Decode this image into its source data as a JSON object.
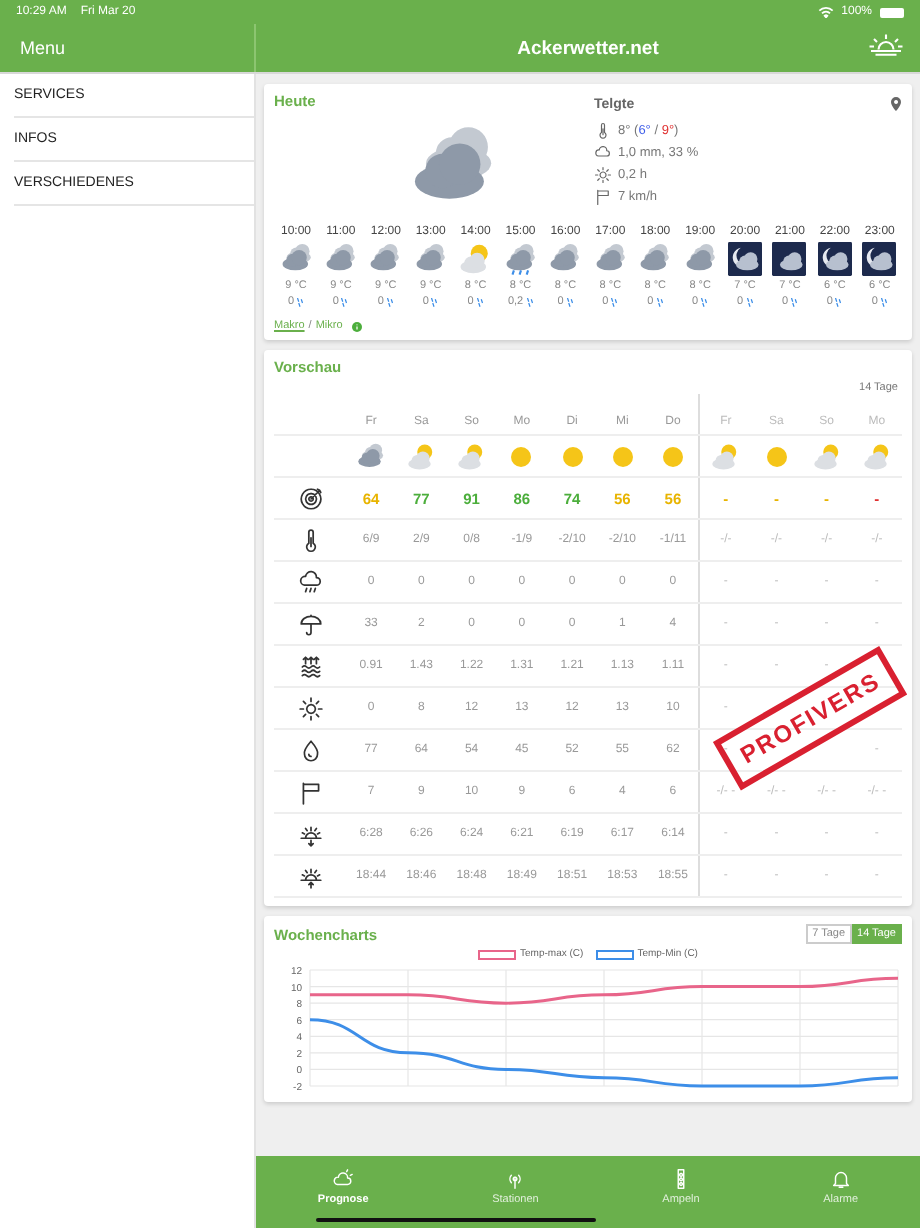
{
  "status_bar": {
    "time": "10:29 AM",
    "date": "Fri Mar 20",
    "battery": "100%"
  },
  "header": {
    "menu_title": "Menu",
    "title": "Ackerwetter.net"
  },
  "sidebar": {
    "items": [
      {
        "label": "SERVICES"
      },
      {
        "label": "INFOS"
      },
      {
        "label": "VERSCHIEDENES"
      }
    ]
  },
  "today": {
    "title": "Heute",
    "location": "Telgte",
    "temperature": [
      {
        "text": "8° (",
        "kind": "plain"
      },
      {
        "text": "6°",
        "kind": "min"
      },
      {
        "text": " / ",
        "kind": "plain"
      },
      {
        "text": "9°",
        "kind": "max"
      },
      {
        "text": ")",
        "kind": "plain"
      }
    ],
    "details": [
      {
        "kind": "rain",
        "text": "1,0 mm, 33 %"
      },
      {
        "kind": "sun",
        "text": "0,2 h"
      },
      {
        "kind": "wind",
        "text": "7 km/h"
      }
    ],
    "hours": [
      {
        "time": "10:00",
        "kind": "cloudy",
        "temp": "9 °C",
        "rain": "0"
      },
      {
        "time": "11:00",
        "kind": "cloudy",
        "temp": "9 °C",
        "rain": "0"
      },
      {
        "time": "12:00",
        "kind": "cloudy",
        "temp": "9 °C",
        "rain": "0"
      },
      {
        "time": "13:00",
        "kind": "cloudy",
        "temp": "9 °C",
        "rain": "0"
      },
      {
        "time": "14:00",
        "kind": "sun-cloud",
        "temp": "8 °C",
        "rain": "0"
      },
      {
        "time": "15:00",
        "kind": "rain",
        "temp": "8 °C",
        "rain": "0,2"
      },
      {
        "time": "16:00",
        "kind": "cloudy",
        "temp": "8 °C",
        "rain": "0"
      },
      {
        "time": "17:00",
        "kind": "cloudy",
        "temp": "8 °C",
        "rain": "0"
      },
      {
        "time": "18:00",
        "kind": "cloudy",
        "temp": "8 °C",
        "rain": "0"
      },
      {
        "time": "19:00",
        "kind": "cloudy",
        "temp": "8 °C",
        "rain": "0"
      },
      {
        "time": "20:00",
        "kind": "night",
        "temp": "7 °C",
        "rain": "0"
      },
      {
        "time": "21:00",
        "kind": "night-cloudy",
        "temp": "7 °C",
        "rain": "0"
      },
      {
        "time": "22:00",
        "kind": "night",
        "temp": "6 °C",
        "rain": "0"
      },
      {
        "time": "23:00",
        "kind": "night",
        "temp": "6 °C",
        "rain": "0"
      }
    ],
    "links": [
      {
        "label": "Makro",
        "selected": true
      },
      {
        "label": "Mikro",
        "selected": false
      }
    ],
    "link_separator": "/"
  },
  "forecast": {
    "title": "Vorschau",
    "extended_label": "14 Tage",
    "days": [
      {
        "label": "Fr",
        "kind": "cloudy",
        "extended": false
      },
      {
        "label": "Sa",
        "kind": "sun-cloud",
        "extended": false
      },
      {
        "label": "So",
        "kind": "sun-cloud",
        "extended": false
      },
      {
        "label": "Mo",
        "kind": "sun",
        "extended": false
      },
      {
        "label": "Di",
        "kind": "sun",
        "extended": false
      },
      {
        "label": "Mi",
        "kind": "sun",
        "extended": false
      },
      {
        "label": "Do",
        "kind": "sun",
        "extended": false
      },
      {
        "label": "Fr",
        "kind": "sun-cloud",
        "extended": true
      },
      {
        "label": "Sa",
        "kind": "sun",
        "extended": true
      },
      {
        "label": "So",
        "kind": "sun-cloud",
        "extended": true
      },
      {
        "label": "Mo",
        "kind": "sun-cloud",
        "extended": true
      }
    ],
    "rows": [
      {
        "kind": "target",
        "cells": [
          {
            "text": "64",
            "color": "#e8b400"
          },
          {
            "text": "77",
            "color": "#4cae3c"
          },
          {
            "text": "91",
            "color": "#4cae3c"
          },
          {
            "text": "86",
            "color": "#4cae3c"
          },
          {
            "text": "74",
            "color": "#4cae3c"
          },
          {
            "text": "56",
            "color": "#e8b400"
          },
          {
            "text": "56",
            "color": "#e8b400"
          },
          {
            "text": "-",
            "color": "#e8b400"
          },
          {
            "text": "-",
            "color": "#e8b400"
          },
          {
            "text": "-",
            "color": "#e8b400"
          },
          {
            "text": "-",
            "color": "#e03030"
          }
        ]
      },
      {
        "kind": "thermometer",
        "cells": [
          {
            "text": "6/9"
          },
          {
            "text": "2/9"
          },
          {
            "text": "0/8"
          },
          {
            "text": "-1/9"
          },
          {
            "text": "-2/10"
          },
          {
            "text": "-2/10"
          },
          {
            "text": "-1/11"
          },
          {
            "text": "-/-"
          },
          {
            "text": "-/-"
          },
          {
            "text": "-/-"
          },
          {
            "text": "-/-"
          }
        ]
      },
      {
        "kind": "rain-cloud",
        "cells": [
          {
            "text": "0"
          },
          {
            "text": "0"
          },
          {
            "text": "0"
          },
          {
            "text": "0"
          },
          {
            "text": "0"
          },
          {
            "text": "0"
          },
          {
            "text": "0"
          },
          {
            "text": "-"
          },
          {
            "text": "-"
          },
          {
            "text": "-"
          },
          {
            "text": "-"
          }
        ]
      },
      {
        "kind": "umbrella",
        "cells": [
          {
            "text": "33"
          },
          {
            "text": "2"
          },
          {
            "text": "0"
          },
          {
            "text": "0"
          },
          {
            "text": "0"
          },
          {
            "text": "1"
          },
          {
            "text": "4"
          },
          {
            "text": "-"
          },
          {
            "text": "-"
          },
          {
            "text": "-"
          },
          {
            "text": "-"
          }
        ]
      },
      {
        "kind": "evaporation",
        "cells": [
          {
            "text": "0.91"
          },
          {
            "text": "1.43"
          },
          {
            "text": "1.22"
          },
          {
            "text": "1.31"
          },
          {
            "text": "1.21"
          },
          {
            "text": "1.13"
          },
          {
            "text": "1.11"
          },
          {
            "text": "-"
          },
          {
            "text": "-"
          },
          {
            "text": "-"
          },
          {}
        ]
      },
      {
        "kind": "sun",
        "cells": [
          {
            "text": "0"
          },
          {
            "text": "8"
          },
          {
            "text": "12"
          },
          {
            "text": "13"
          },
          {
            "text": "12"
          },
          {
            "text": "13"
          },
          {
            "text": "10"
          },
          {
            "text": "-"
          },
          {},
          {},
          {}
        ]
      },
      {
        "kind": "drop",
        "cells": [
          {
            "text": "77"
          },
          {
            "text": "64"
          },
          {
            "text": "54"
          },
          {
            "text": "45"
          },
          {
            "text": "52"
          },
          {
            "text": "55"
          },
          {
            "text": "62"
          },
          {
            "text": "-"
          },
          {},
          {},
          {
            "text": "-"
          }
        ]
      },
      {
        "kind": "wind",
        "cells": [
          {
            "text": "7"
          },
          {
            "text": "9"
          },
          {
            "text": "10"
          },
          {
            "text": "9"
          },
          {
            "text": "6"
          },
          {
            "text": "4"
          },
          {
            "text": "6"
          },
          {
            "text": "-/- -"
          },
          {
            "text": "-/- -"
          },
          {
            "text": "-/- -"
          },
          {
            "text": "-/- -"
          }
        ]
      },
      {
        "kind": "sunrise",
        "cells": [
          {
            "text": "6:28"
          },
          {
            "text": "6:26"
          },
          {
            "text": "6:24"
          },
          {
            "text": "6:21"
          },
          {
            "text": "6:19"
          },
          {
            "text": "6:17"
          },
          {
            "text": "6:14"
          },
          {
            "text": "-"
          },
          {
            "text": "-"
          },
          {
            "text": "-"
          },
          {
            "text": "-"
          }
        ]
      },
      {
        "kind": "sunset",
        "cells": [
          {
            "text": "18:44"
          },
          {
            "text": "18:46"
          },
          {
            "text": "18:48"
          },
          {
            "text": "18:49"
          },
          {
            "text": "18:51"
          },
          {
            "text": "18:53"
          },
          {
            "text": "18:55"
          },
          {
            "text": "-"
          },
          {
            "text": "-"
          },
          {
            "text": "-"
          },
          {
            "text": "-"
          }
        ]
      }
    ],
    "stamp": "PROFIVERS"
  },
  "charts": {
    "title": "Wochencharts",
    "ranges": [
      {
        "label": "7 Tage",
        "selected": false
      },
      {
        "label": "14 Tage",
        "selected": true
      }
    ],
    "chart_data": {
      "type": "line",
      "ylim": [
        -2,
        12
      ],
      "yticks": [
        -2,
        0,
        2,
        4,
        6,
        8,
        10,
        12
      ],
      "grid": true,
      "series": [
        {
          "name": "Temp-max (C)",
          "color": "#e8658a",
          "values": [
            9,
            9,
            8,
            9,
            10,
            10,
            11
          ]
        },
        {
          "name": "Temp-Min (C)",
          "color": "#3d8ee8",
          "values": [
            6,
            2,
            0,
            -1,
            -2,
            -2,
            -1
          ]
        }
      ]
    }
  },
  "tab_bar": [
    {
      "label": "Prognose",
      "kind": "sun-cloud",
      "selected": true
    },
    {
      "label": "Stationen",
      "kind": "antenna",
      "selected": false
    },
    {
      "label": "Ampeln",
      "kind": "traffic-light",
      "selected": false
    },
    {
      "label": "Alarme",
      "kind": "bell",
      "selected": false
    }
  ]
}
